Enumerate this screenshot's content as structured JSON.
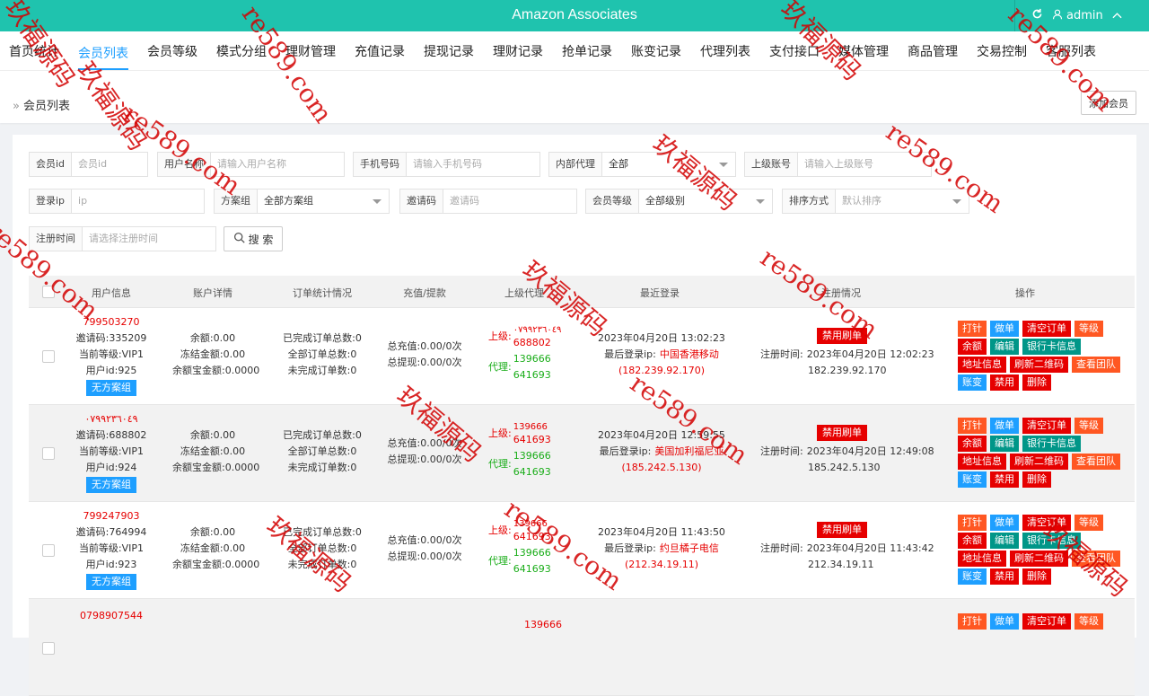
{
  "app": {
    "title": "Amazon Associates",
    "user": "admin"
  },
  "nav": {
    "tabs": [
      "首页统计",
      "会员列表",
      "会员等级",
      "模式分组",
      "理财管理",
      "充值记录",
      "提现记录",
      "理财记录",
      "抢单记录",
      "账变记录",
      "代理列表",
      "支付接口",
      "媒体管理",
      "商品管理",
      "交易控制",
      "客服列表"
    ],
    "active": 1
  },
  "breadcrumb": {
    "current": "会员列表"
  },
  "add_member_label": "添加会员",
  "filters": {
    "member_id": {
      "label": "会员id",
      "placeholder": "会员id"
    },
    "username": {
      "label": "用户名称",
      "placeholder": "请输入用户名称"
    },
    "phone": {
      "label": "手机号码",
      "placeholder": "请输入手机号码"
    },
    "internal_agent": {
      "label": "内部代理",
      "value": "全部"
    },
    "parent_account": {
      "label": "上级账号",
      "placeholder": "请输入上级账号"
    },
    "login_ip": {
      "label": "登录ip",
      "placeholder": "ip"
    },
    "plan_group": {
      "label": "方案组",
      "value": "全部方案组"
    },
    "invite_code": {
      "label": "邀请码",
      "placeholder": "邀请码"
    },
    "member_level": {
      "label": "会员等级",
      "value": "全部级别"
    },
    "sort": {
      "label": "排序方式",
      "placeholder": "默认排序"
    },
    "reg_time": {
      "label": "注册时间",
      "placeholder": "请选择注册时间"
    },
    "search_label": "搜 索"
  },
  "table": {
    "headers": [
      "用户信息",
      "账户详情",
      "订单统计情况",
      "充值/提款",
      "上级代理",
      "最近登录",
      "注册情况",
      "操作"
    ],
    "rows": [
      {
        "phone": "799503270",
        "invite": "邀请码:335209",
        "level": "当前等级:VIP1",
        "uid": "用户id:925",
        "plan": "无方案组",
        "balance": "余额:0.00",
        "frozen": "冻结金额:0.00",
        "yeb": "余额宝金额:0.0000",
        "done": "已完成订单总数:0",
        "all": "全部订单总数:0",
        "undone": "未完成订单数:0",
        "recharge": "总充值:0.00/0次",
        "withdraw": "总提现:0.00/0次",
        "sup_label": "上级:",
        "sup_a": "٠٧٩٩٢٣٦٠٤٩",
        "sup_b": "688802",
        "agent_label": "代理:",
        "agent_a": "139666",
        "agent_b": "641693",
        "login_time": "2023年04月20日 13:02:23",
        "login_ip_label": "最后登录ip:",
        "login_loc": "中国香港移动",
        "login_ip": "(182.239.92.170)",
        "ban": "禁用刷单",
        "reg_label": "注册时间:",
        "reg_time": "2023年04月20日 12:02:23",
        "reg_ip": "182.239.92.170"
      },
      {
        "phone": "٠٧٩٩٢٣٦٠٤٩",
        "invite": "邀请码:688802",
        "level": "当前等级:VIP1",
        "uid": "用户id:924",
        "plan": "无方案组",
        "balance": "余额:0.00",
        "frozen": "冻结金额:0.00",
        "yeb": "余额宝金额:0.0000",
        "done": "已完成订单总数:0",
        "all": "全部订单总数:0",
        "undone": "未完成订单数:0",
        "recharge": "总充值:0.00/0次",
        "withdraw": "总提现:0.00/0次",
        "sup_label": "上级:",
        "sup_a": "139666",
        "sup_b": "641693",
        "agent_label": "代理:",
        "agent_a": "139666",
        "agent_b": "641693",
        "login_time": "2023年04月20日 12:59:55",
        "login_ip_label": "最后登录ip:",
        "login_loc": "美国加利福尼亚",
        "login_ip": "(185.242.5.130)",
        "ban": "禁用刷单",
        "reg_label": "注册时间:",
        "reg_time": "2023年04月20日 12:49:08",
        "reg_ip": "185.242.5.130"
      },
      {
        "phone": "799247903",
        "invite": "邀请码:764994",
        "level": "当前等级:VIP1",
        "uid": "用户id:923",
        "plan": "无方案组",
        "balance": "余额:0.00",
        "frozen": "冻结金额:0.00",
        "yeb": "余额宝金额:0.0000",
        "done": "已完成订单总数:0",
        "all": "全部订单总数:0",
        "undone": "未完成订单数:0",
        "recharge": "总充值:0.00/0次",
        "withdraw": "总提现:0.00/0次",
        "sup_label": "上级:",
        "sup_a": "139666",
        "sup_b": "641693",
        "agent_label": "代理:",
        "agent_a": "139666",
        "agent_b": "641693",
        "login_time": "2023年04月20日 11:43:50",
        "login_ip_label": "最后登录ip:",
        "login_loc": "约旦橘子电信",
        "login_ip": "(212.34.19.11)",
        "ban": "禁用刷单",
        "reg_label": "注册时间:",
        "reg_time": "2023年04月20日 11:43:42",
        "reg_ip": "212.34.19.11"
      },
      {
        "phone": "0798907544",
        "sup_a": "139666"
      }
    ],
    "ops": [
      "打针",
      "做单",
      "清空订单",
      "等级",
      "余额",
      "编辑",
      "银行卡信息",
      "地址信息",
      "刷新二维码",
      "查看团队",
      "账变",
      "禁用",
      "删除"
    ]
  },
  "watermarks": [
    "玖福源码",
    "re589.com"
  ],
  "colors": {
    "header": "#1fc3ae",
    "primary": "#1e9fff",
    "danger": "#e60000",
    "warn": "#ff5722",
    "teal": "#009688"
  }
}
